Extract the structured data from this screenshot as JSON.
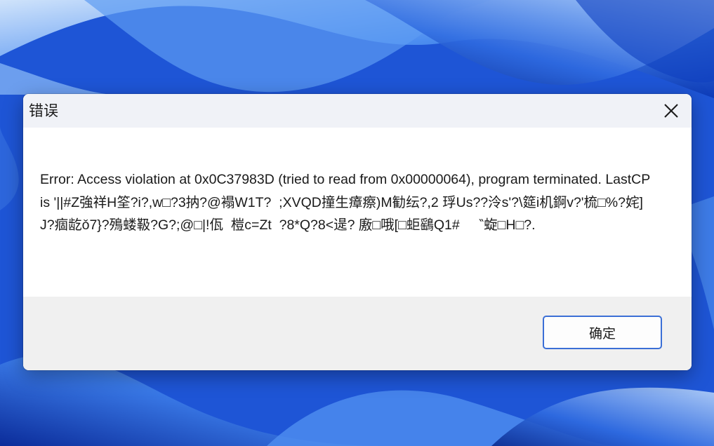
{
  "dialog": {
    "title": "错误",
    "message": "Error: Access violation at 0x0C37983D (tried to read from 0x00000064), program terminated. LastCP is '||#Z強祥H筌?i?,w□?3抐?@褟W1T?  ;XVQD撞生瘴瘵)M勧纭?,2 琈Us??泠s'?\\筵i机錒v?'梳□%?姹]J?痼龁ǒ7}?殦蝼靸?G?;@□|!佤  榿c=Zt  ?8*Q?8<遈? 廒□哦[□蚷鷂Q1#     ‶蜁□H□?.",
    "ok_label": "确定",
    "close_icon": "close-icon"
  },
  "colors": {
    "titlebar_bg": "#f0f2f7",
    "footer_bg": "#f0f0f0",
    "button_border": "#3b6fd6",
    "wallpaper_accent": "#1a4fd0"
  }
}
